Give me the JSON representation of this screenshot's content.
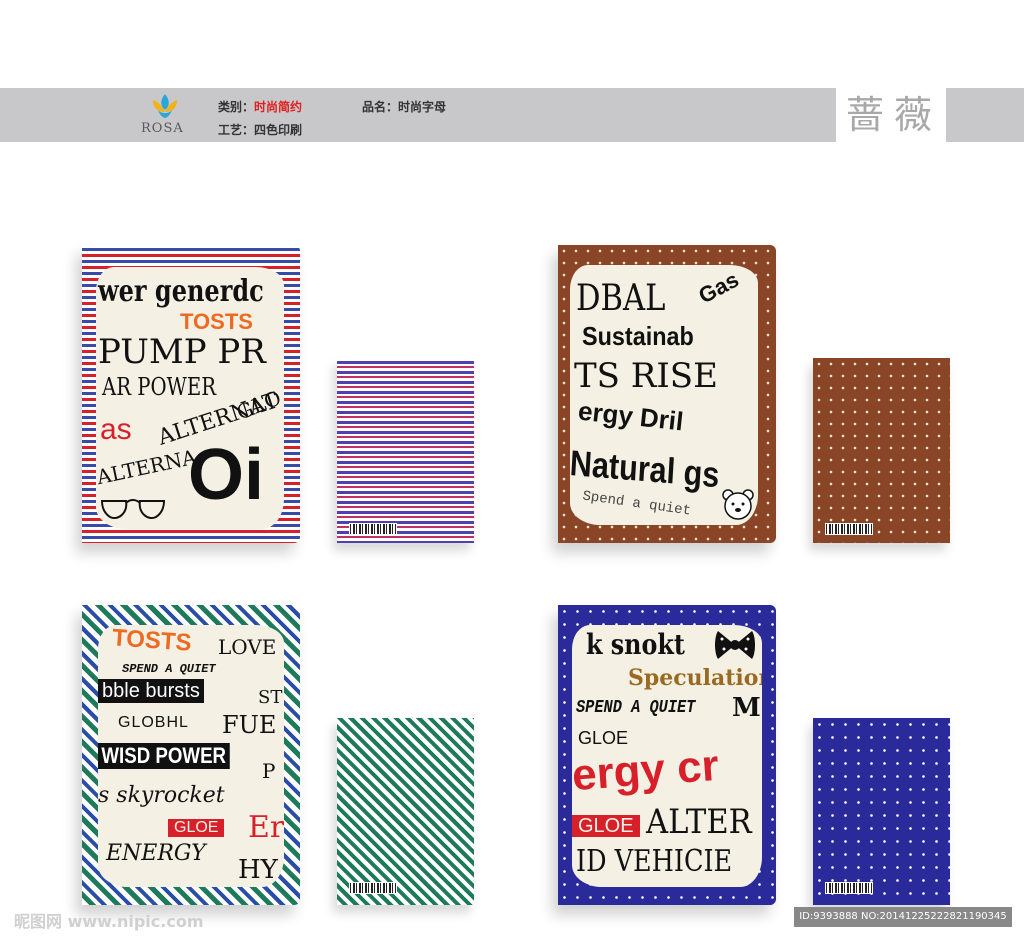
{
  "header": {
    "logo_text": "ROSA",
    "category_label": "类别：",
    "category_value": "时尚简约",
    "product_label": "品名：",
    "product_value": "时尚字母",
    "craft_label": "工艺：",
    "craft_value": "四色印刷",
    "brand_name": "蔷薇"
  },
  "notebooks": [
    {
      "style": "red-blue-stripes",
      "words": [
        "wer generdc",
        "TOSTS",
        "PUMP PR",
        "AR POWER",
        "ALTERNAT",
        "as",
        "GLO",
        "ALTERNA",
        "Oi"
      ]
    },
    {
      "style": "brown-dots",
      "words": [
        "DBAL",
        "Gas",
        "Sustainab",
        "TS RISE",
        "ergy Dril",
        "Natural gs",
        "Spend a quiet"
      ]
    },
    {
      "style": "green-diagonal-stripes",
      "words": [
        "TOSTS",
        "LOVE",
        "SPEND A QUIET",
        "bble bursts",
        "ST",
        "GLOBHL",
        "FUE",
        "WISD POWER",
        "P",
        "s skyrocket",
        "GLOE",
        "Er",
        "ENERGY",
        "HY"
      ]
    },
    {
      "style": "blue-dots",
      "words": [
        "k snokt",
        "Speculation",
        "SPEND A QUIET",
        "M",
        "GLOE",
        "ergy cr",
        "GLOE",
        "ALTER",
        "ID VEHICIE"
      ]
    }
  ],
  "watermark": {
    "left": "昵图网 www.nipic.com",
    "right": "ID:9393888 NO:20141225222821190345"
  },
  "colors": {
    "header_band": "#c8c8ca",
    "accent_red": "#e02020",
    "brown": "#8a4426",
    "navy": "#2a2a9a",
    "green": "#1e7a5a"
  }
}
